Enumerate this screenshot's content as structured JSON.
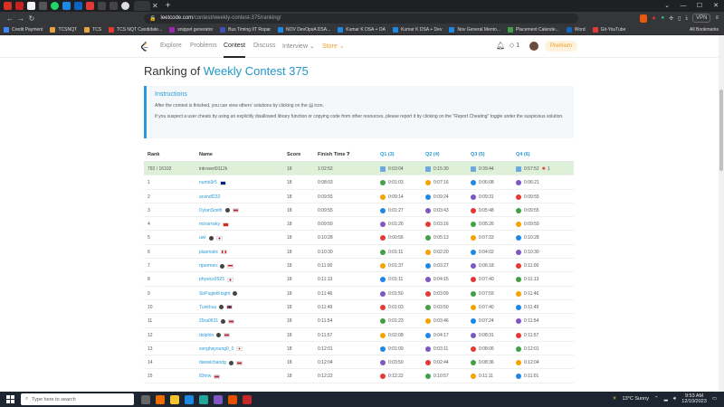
{
  "browser": {
    "url_host": "leetcode.com",
    "url_path": "/contest/weekly-contest-375/ranking/",
    "vpn_label": "VPN",
    "bookmarks": [
      {
        "label": "Credit Payment",
        "color": "#4285f4"
      },
      {
        "label": "TCSNQT",
        "color": "#e8a33d"
      },
      {
        "label": "TCS",
        "color": "#e8a33d"
      },
      {
        "label": "TCS NQT Candidate...",
        "color": "#e53935"
      },
      {
        "label": "snippet generator",
        "color": "#9c27b0"
      },
      {
        "label": "Bus Timing IIT Ropar",
        "color": "#3f51b5"
      },
      {
        "label": "NOV DevOpsA DSA...",
        "color": "#1e88e5"
      },
      {
        "label": "Kumar K DSA + OA",
        "color": "#1e88e5"
      },
      {
        "label": "Kumar K DSA + Dev",
        "color": "#1e88e5"
      },
      {
        "label": "Nov General Mento...",
        "color": "#1e88e5"
      },
      {
        "label": "Placement Calende...",
        "color": "#43a047"
      },
      {
        "label": "Word",
        "color": "#1565c0"
      },
      {
        "label": "Git-YouTube",
        "color": "#e53935"
      }
    ],
    "all_bookmarks": "All Bookmarks"
  },
  "nav": {
    "items": [
      "Explore",
      "Problems",
      "Contest",
      "Discuss",
      "Interview",
      "Store"
    ],
    "active": "Contest",
    "streak": "1",
    "premium": "Premium"
  },
  "page": {
    "title_prefix": "Ranking of ",
    "title_contest": "Weekly Contest 375"
  },
  "instructions": {
    "heading": "Instructions",
    "line1": "After the contest is finished, you can view others' solutions by clicking on the ▤ icon.",
    "line2": "If you suspect a user cheats by using an explicitly disallowed library function or copying code from other resources, please report it by clicking on the \"Report Cheating\" toggle under the suspicious solution."
  },
  "table": {
    "headers": [
      "Rank",
      "Name",
      "Score",
      "Finish Time",
      "Q1 (3)",
      "Q2 (4)",
      "Q3 (5)",
      "Q4 (6)"
    ],
    "rows": [
      {
        "rank": "792 / 16102",
        "name": "introvert9112k",
        "flag": "",
        "badge": false,
        "score": "18",
        "finish": "1:02:52",
        "q1": "0:03:04",
        "q2": "0:15:30",
        "q3": "0:39:44",
        "q4": "0:57:52",
        "q4_extra": "1",
        "me": true
      },
      {
        "rank": "1",
        "name": "numb3r5",
        "flag": "au",
        "badge": false,
        "score": "18",
        "finish": "0:08:03",
        "q1": "0:01:03",
        "q2": "0:07:16",
        "q3": "0:06:08",
        "q4": "0:06:21",
        "q4_extra": ""
      },
      {
        "rank": "2",
        "name": "arvindf232",
        "flag": "",
        "badge": false,
        "score": "18",
        "finish": "0:09:55",
        "q1": "0:09:14",
        "q2": "0:09:24",
        "q3": "0:09:31",
        "q4": "0:09:55",
        "q4_extra": ""
      },
      {
        "rank": "3",
        "name": "DylanSmith",
        "flag": "us",
        "badge": true,
        "score": "18",
        "finish": "0:09:55",
        "q1": "0:01:27",
        "q2": "0:03:43",
        "q3": "0:05:48",
        "q4": "0:09:55",
        "q4_extra": ""
      },
      {
        "rank": "4",
        "name": "mzrarnsky",
        "flag": "vn",
        "badge": false,
        "score": "18",
        "finish": "0:09:59",
        "q1": "0:01:26",
        "q2": "0:03:16",
        "q3": "0:05:26",
        "q4": "0:09:59",
        "q4_extra": ""
      },
      {
        "rank": "5",
        "name": "uwi",
        "flag": "jp",
        "badge": true,
        "score": "18",
        "finish": "0:10:28",
        "q1": "0:00:56",
        "q2": "0:05:13",
        "q3": "0:07:33",
        "q4": "0:10:28",
        "q4_extra": ""
      },
      {
        "rank": "6",
        "name": "plasmatic",
        "flag": "ca",
        "badge": false,
        "score": "18",
        "finish": "0:10:30",
        "q1": "0:01:11",
        "q2": "0:02:20",
        "q3": "0:04:02",
        "q4": "0:10:30",
        "q4_extra": ""
      },
      {
        "rank": "7",
        "name": "rtpermen",
        "flag": "id",
        "badge": true,
        "score": "18",
        "finish": "0:11:00",
        "q1": "0:01:37",
        "q2": "0:03:27",
        "q3": "0:06:18",
        "q4": "0:11:00",
        "q4_extra": ""
      },
      {
        "rank": "8",
        "name": "physics0523",
        "flag": "jp",
        "badge": false,
        "score": "18",
        "finish": "0:11:13",
        "q1": "0:01:11",
        "q2": "0:04:15",
        "q3": "0:07:40",
        "q4": "0:11:13",
        "q4_extra": ""
      },
      {
        "rank": "9",
        "name": "SirPugletKnight",
        "flag": "",
        "badge": true,
        "score": "18",
        "finish": "0:11:46",
        "q1": "0:01:50",
        "q2": "0:03:09",
        "q3": "0:07:59",
        "q4": "0:11:46",
        "q4_extra": ""
      },
      {
        "rank": "10",
        "name": "Tunkhuu",
        "flag": "mn",
        "badge": true,
        "score": "18",
        "finish": "0:11:49",
        "q1": "0:01:03",
        "q2": "0:03:50",
        "q3": "0:07:40",
        "q4": "0:11:49",
        "q4_extra": ""
      },
      {
        "rank": "11",
        "name": "25ra0631",
        "flag": "us",
        "badge": true,
        "score": "18",
        "finish": "0:11:54",
        "q1": "0:01:23",
        "q2": "0:03:46",
        "q3": "0:07:24",
        "q4": "0:11:54",
        "q4_extra": ""
      },
      {
        "rank": "12",
        "name": "dolphin",
        "flag": "us",
        "badge": true,
        "score": "18",
        "finish": "0:11:57",
        "q1": "0:02:08",
        "q2": "0:04:17",
        "q3": "0:08:31",
        "q4": "0:11:57",
        "q4_extra": ""
      },
      {
        "rank": "13",
        "name": "songhayoung0_0",
        "flag": "kr",
        "badge": false,
        "score": "18",
        "finish": "0:12:01",
        "q1": "0:01:09",
        "q2": "0:03:11",
        "q3": "0:08:06",
        "q4": "0:12:01",
        "q4_extra": ""
      },
      {
        "rank": "14",
        "name": "danielchandg",
        "flag": "us",
        "badge": true,
        "score": "18",
        "finish": "0:12:04",
        "q1": "0:03:50",
        "q2": "0:02:44",
        "q3": "0:08:36",
        "q4": "0:12:04",
        "q4_extra": ""
      },
      {
        "rank": "15",
        "name": "83mw",
        "flag": "us",
        "badge": false,
        "score": "18",
        "finish": "0:12:22",
        "q1": "0:12:22",
        "q2": "0:10:57",
        "q3": "0:11:11",
        "q4": "0:11:01",
        "q4_extra": ""
      }
    ]
  },
  "taskbar": {
    "search_placeholder": "Type here to search",
    "weather": "13°C  Sunny",
    "time": "9:53 AM",
    "date": "12/10/2023"
  },
  "colors": {
    "accent": "#2196c9",
    "highlight_row": "#dff0d8",
    "premium": "#e99a2a"
  }
}
